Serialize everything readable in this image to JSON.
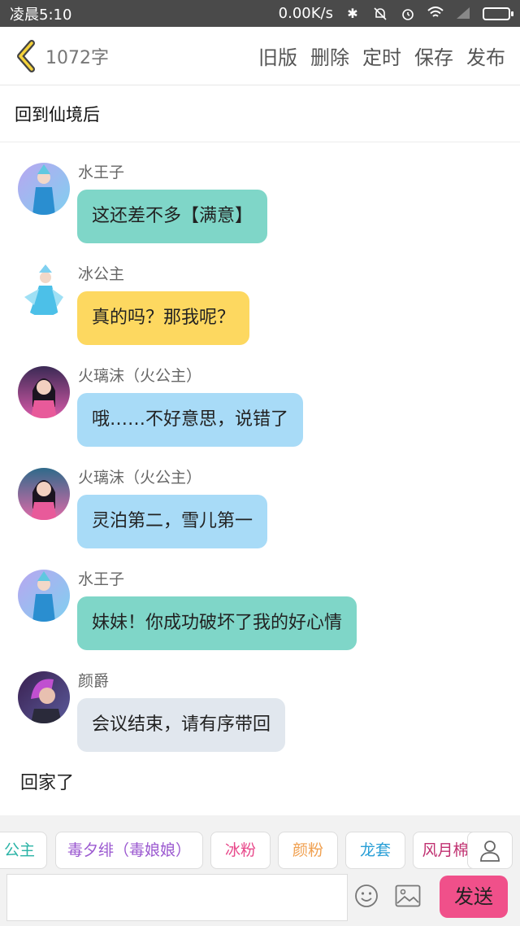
{
  "status_bar": {
    "time": "凌晨5:10",
    "speed": "0.00K/s"
  },
  "header": {
    "word_count": "1072字",
    "actions": [
      "旧版",
      "删除",
      "定时",
      "保存",
      "发布"
    ]
  },
  "title": "回到仙境后",
  "messages": [
    {
      "name": "水王子",
      "text": "这还差不多【满意】",
      "bubble_color": "#7fd6c8",
      "avatar": "water-prince"
    },
    {
      "name": "冰公主",
      "text": "真的吗？那我呢？",
      "bubble_color": "#fdd860",
      "avatar": "ice-princess"
    },
    {
      "name": "火璃沫（火公主）",
      "text": "哦……不好意思，说错了",
      "bubble_color": "#a8dbf7",
      "avatar": "fire-princess"
    },
    {
      "name": "火璃沫（火公主）",
      "text": "灵泊第二，雪儿第一",
      "bubble_color": "#a8dbf7",
      "avatar": "fire-princess"
    },
    {
      "name": "水王子",
      "text": "妹妹！你成功破坏了我的好心情",
      "bubble_color": "#7fd6c8",
      "avatar": "water-prince"
    },
    {
      "name": "颜爵",
      "text": "会议结束，请有序带回",
      "bubble_color": "#e1e7ee",
      "avatar": "yan-jue"
    }
  ],
  "narration": "回家了",
  "character_tags": [
    {
      "label": "公主",
      "color": "#2ab3a6"
    },
    {
      "label": "毒夕绯（毒娘娘）",
      "color": "#9b59d0"
    },
    {
      "label": "冰粉",
      "color": "#e8488a"
    },
    {
      "label": "颜粉",
      "color": "#f0a050"
    },
    {
      "label": "龙套",
      "color": "#2a9fd6"
    },
    {
      "label": "风月棉",
      "color": "#c03070"
    }
  ],
  "composer": {
    "send_label": "发送"
  }
}
